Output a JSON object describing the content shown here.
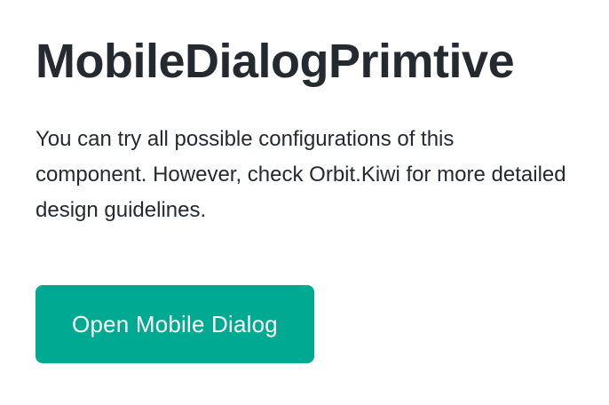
{
  "page": {
    "title": "MobileDialogPrimtive",
    "description": "You can try all possible configurations of this component. However, check Orbit.Kiwi for more detailed design guidelines.",
    "open_button_label": "Open Mobile Dialog"
  },
  "colors": {
    "text": "#252a31",
    "button_background": "#00a991",
    "button_text": "#ffffff",
    "page_background": "#ffffff"
  }
}
